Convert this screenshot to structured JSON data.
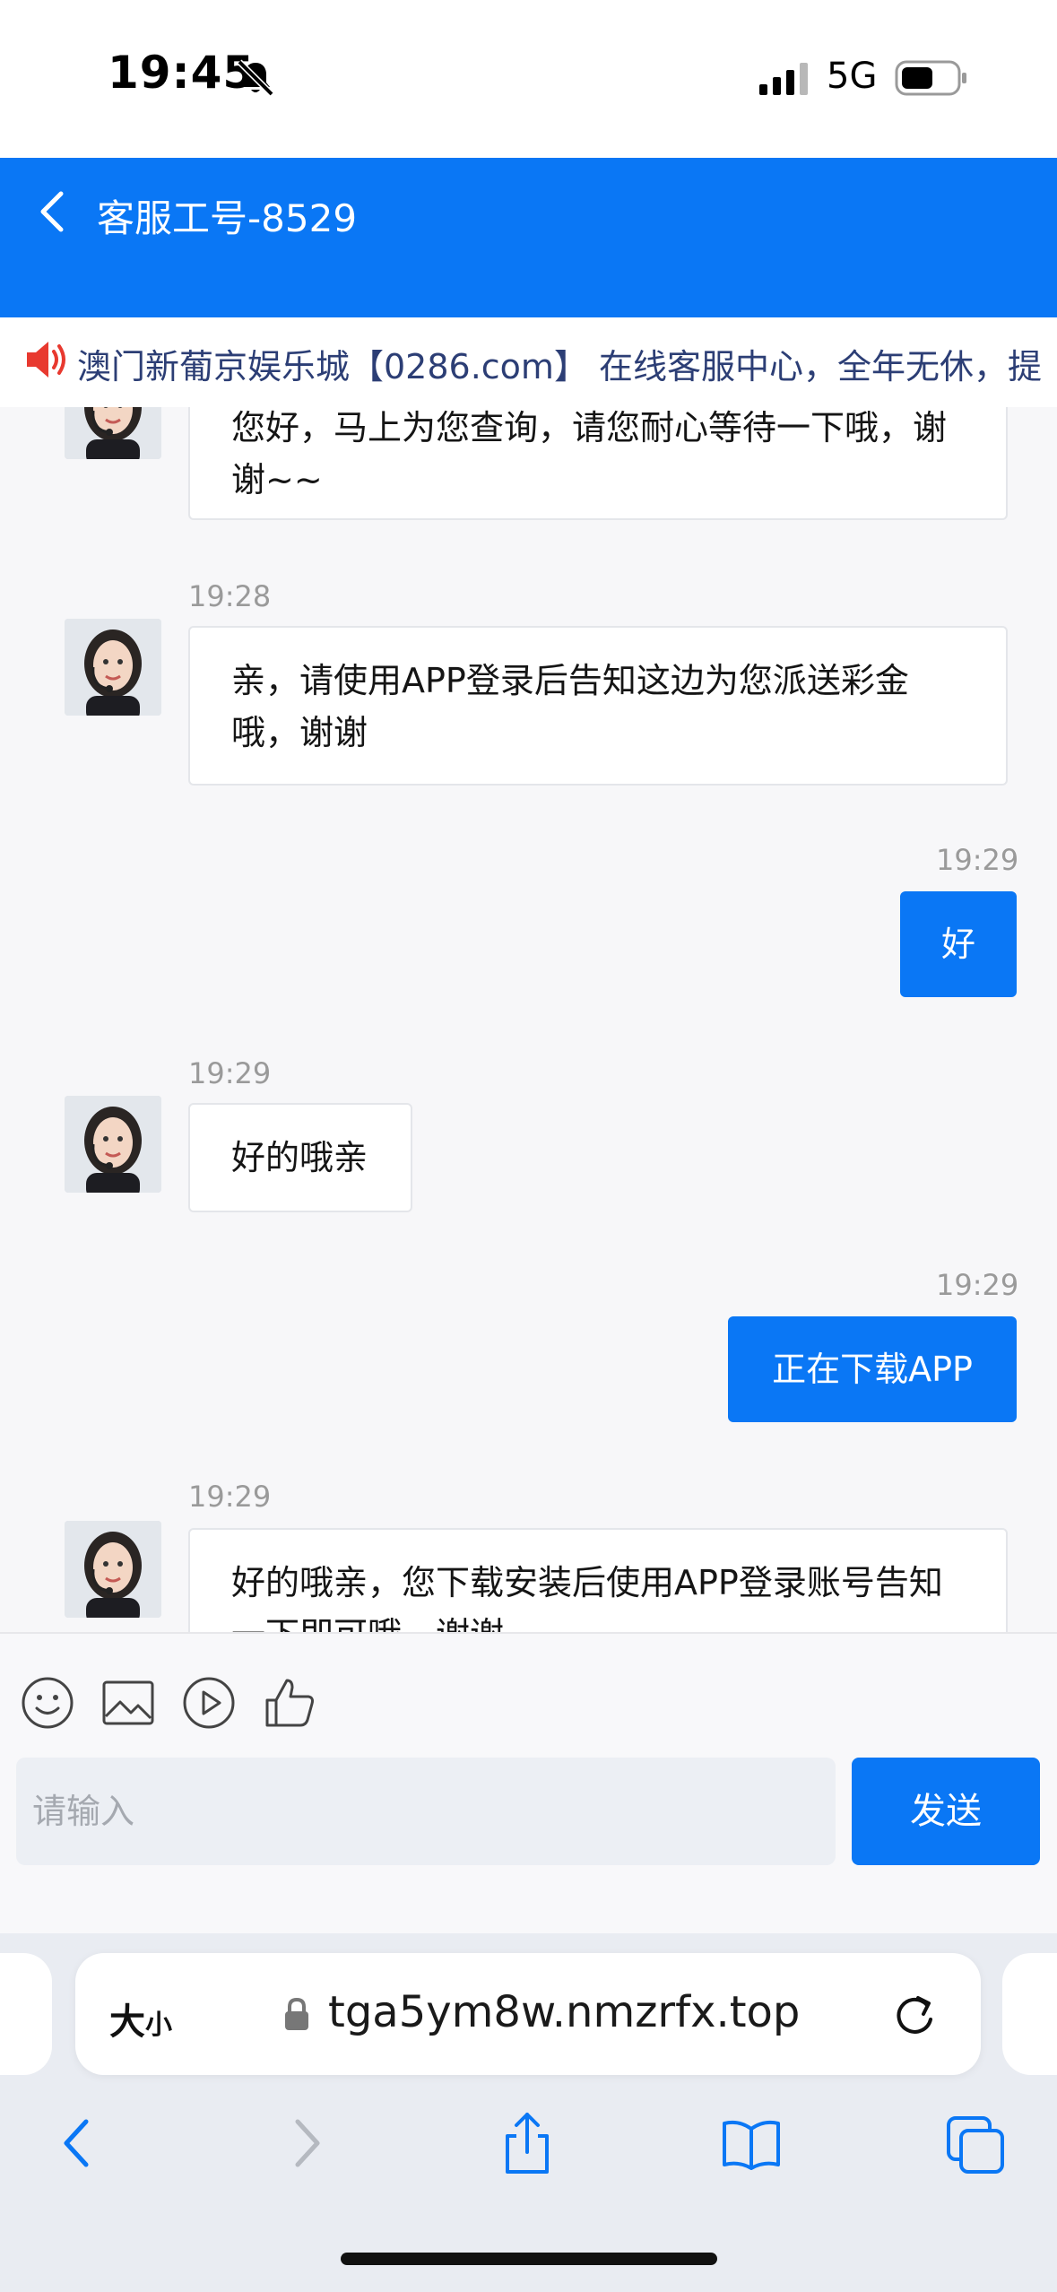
{
  "status_bar": {
    "time": "19:45",
    "network": "5G",
    "icons": [
      "bell-slash-icon",
      "signal-icon",
      "battery-icon"
    ]
  },
  "header": {
    "title": "客服工号-8529",
    "back_icon": "chevron-left-icon",
    "bg_color": "#0a77f5"
  },
  "notice": {
    "icon": "speaker-icon",
    "text": "澳门新葡京娱乐城【0286.com】 在线客服中心，全年无休，提"
  },
  "messages": [
    {
      "side": "agent",
      "time": "",
      "text_line1": "您好，马上为您查询，请您耐心等待一下哦，谢",
      "text_line2": "谢~~"
    },
    {
      "side": "agent",
      "time": "19:28",
      "text_line1": "亲，请使用APP登录后告知这边为您派送彩金",
      "text_line2": "哦，谢谢"
    },
    {
      "side": "user",
      "time": "19:29",
      "text": "好"
    },
    {
      "side": "agent",
      "time": "19:29",
      "text": "好的哦亲"
    },
    {
      "side": "user",
      "time": "19:29",
      "text": "正在下载APP"
    },
    {
      "side": "agent",
      "time": "19:29",
      "text_line1": "好的哦亲，您下载安装后使用APP登录账号告知",
      "text_line2": "一下即可哦，谢谢"
    }
  ],
  "toolbar": {
    "icons": [
      "emoji-icon",
      "image-icon",
      "video-icon",
      "thumbs-up-icon"
    ]
  },
  "input": {
    "placeholder": "请输入",
    "value": ""
  },
  "send_button": {
    "label": "发送"
  },
  "browser": {
    "text_size_big": "大",
    "text_size_small": "小",
    "url": "tga5ym8w.nmzrfx.top",
    "nav_icons": [
      "back-icon",
      "forward-icon",
      "share-icon",
      "bookmarks-icon",
      "tabs-icon"
    ]
  }
}
